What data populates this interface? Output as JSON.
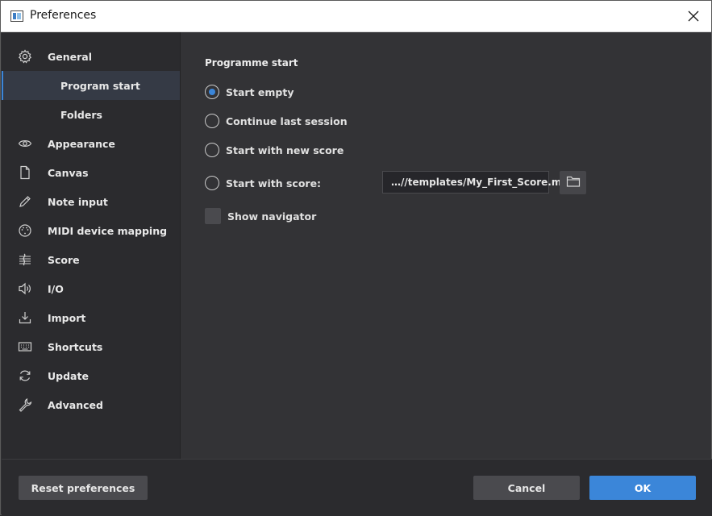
{
  "window": {
    "title": "Preferences"
  },
  "sidebar": {
    "items": [
      {
        "label": "General",
        "icon": "gear-icon"
      },
      {
        "label": "Program start",
        "icon": "",
        "sub": true,
        "selected": true
      },
      {
        "label": "Folders",
        "icon": "",
        "sub": true
      },
      {
        "label": "Appearance",
        "icon": "eye-icon"
      },
      {
        "label": "Canvas",
        "icon": "document-icon"
      },
      {
        "label": "Note input",
        "icon": "pencil-icon"
      },
      {
        "label": "MIDI device mapping",
        "icon": "midi-icon"
      },
      {
        "label": "Score",
        "icon": "score-icon"
      },
      {
        "label": "I/O",
        "icon": "speaker-icon"
      },
      {
        "label": "Import",
        "icon": "import-icon"
      },
      {
        "label": "Shortcuts",
        "icon": "keyboard-icon"
      },
      {
        "label": "Update",
        "icon": "refresh-icon"
      },
      {
        "label": "Advanced",
        "icon": "wrench-icon"
      }
    ]
  },
  "content": {
    "section_title": "Programme start",
    "options": [
      {
        "label": "Start empty",
        "checked": true
      },
      {
        "label": "Continue last session",
        "checked": false
      },
      {
        "label": "Start with new score",
        "checked": false
      },
      {
        "label": "Start with score:",
        "checked": false
      }
    ],
    "score_path": "…//templates/My_First_Score.mscx",
    "show_navigator_label": "Show navigator"
  },
  "footer": {
    "reset_label": "Reset preferences",
    "cancel_label": "Cancel",
    "ok_label": "OK"
  },
  "colors": {
    "accent": "#3b86d9",
    "background": "#333336",
    "sidebar": "#2b2b2e"
  }
}
